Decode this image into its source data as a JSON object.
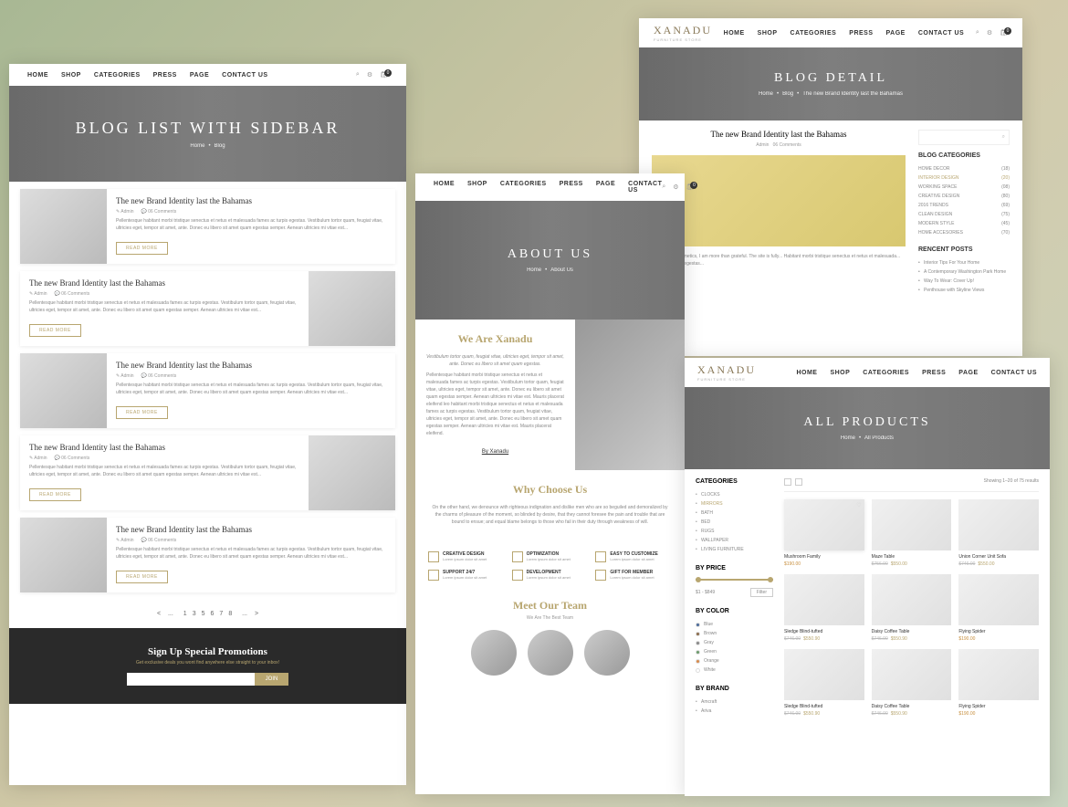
{
  "brand": {
    "name": "XANADU",
    "tagline": "FURNITURE STORE"
  },
  "nav": {
    "home": "HOME",
    "shop": "SHOP",
    "categories": "CATEGORIES",
    "press": "PRESS",
    "page": "PAGE",
    "contact": "CONTACT US"
  },
  "p1": {
    "heroTitle": "BLOG LIST WITH SIDEBAR",
    "breadcrumb": {
      "home": "Home",
      "blog": "Blog"
    },
    "posts": [
      {
        "title": "The new Brand Identity last the Bahamas",
        "author": "Admin",
        "comments": "06 Comments",
        "excerpt": "Pellentesque habitant morbi tristique senectus et netus et malesuada fames ac turpis egestas. Vestibulum tortor quam, feugiat vitae, ultricies eget, tempor sit amet, ante. Donec eu libero sit amet quam egestas semper. Aenean ultricies mi vitae est...",
        "btn": "READ MORE"
      },
      {
        "title": "The new Brand Identity last the Bahamas",
        "author": "Admin",
        "comments": "06 Comments",
        "excerpt": "Pellentesque habitant morbi tristique senectus et netus et malesuada fames ac turpis egestas. Vestibulum tortor quam, feugiat vitae, ultricies eget, tempor sit amet, ante. Donec eu libero sit amet quam egestas semper. Aenean ultricies mi vitae est...",
        "btn": "READ MORE"
      },
      {
        "title": "The new Brand Identity last the Bahamas",
        "author": "Admin",
        "comments": "06 Comments",
        "excerpt": "Pellentesque habitant morbi tristique senectus et netus et malesuada fames ac turpis egestas. Vestibulum tortor quam, feugiat vitae, ultricies eget, tempor sit amet, ante. Donec eu libero sit amet quam egestas semper. Aenean ultricies mi vitae est...",
        "btn": "READ MORE"
      },
      {
        "title": "The new Brand Identity last the Bahamas",
        "author": "Admin",
        "comments": "06 Comments",
        "excerpt": "Pellentesque habitant morbi tristique senectus et netus et malesuada fames ac turpis egestas. Vestibulum tortor quam, feugiat vitae, ultricies eget, tempor sit amet, ante. Donec eu libero sit amet quam egestas semper. Aenean ultricies mi vitae est...",
        "btn": "READ MORE"
      },
      {
        "title": "The new Brand Identity last the Bahamas",
        "author": "Admin",
        "comments": "06 Comments",
        "excerpt": "Pellentesque habitant morbi tristique senectus et netus et malesuada fames ac turpis egestas. Vestibulum tortor quam, feugiat vitae, ultricies eget, tempor sit amet, ante. Donec eu libero sit amet quam egestas semper. Aenean ultricies mi vitae est...",
        "btn": "READ MORE"
      }
    ],
    "pagination": {
      "prev": "<",
      "dots": "...",
      "pages": [
        "1",
        "3",
        "5",
        "6",
        "7",
        "8"
      ],
      "next": ">"
    },
    "signup": {
      "title": "Sign Up Special Promotions",
      "sub": "Get exclusive deals you wont find anywhere else straight to your inbox!",
      "btn": "JOIN"
    }
  },
  "p2": {
    "heroTitle": "ABOUT US",
    "breadcrumb": {
      "home": "Home",
      "about": "About Us"
    },
    "about": {
      "title": "We Are Xanadu",
      "p1": "Vestibulum tortor quam, feugiat vitae, ultricies eget, tempor sit amet, ante. Donec eu libero sit amet quam egestas.",
      "p2": "Pellentesque habitant morbi tristique senectus et netus et malesuada fames ac turpis egestas. Vestibulum tortor quam, feugiat vitae, ultricies eget, tempor sit amet, ante. Donec eu libero sit amet quam egestas semper. Aenean ultricies mi vitae est. Mauris placerat eleifend leo habitant morbi tristique senectus et netus et malesuada fames ac turpis egestas. Vestibulum tortor quam, feugiat vitae, ultricies eget, tempor sit amet, ante. Donec eu libero sit amet quam egestas semper. Aenean ultricies mi vitae est. Mauris placerat eleifend.",
      "link": "By Xanadu"
    },
    "why": {
      "title": "Why Choose Us",
      "sub": "On the other hand, we denounce with righteous indignation and dislike men who are so beguiled and demoralized by the charms of pleasure of the moment, so blinded by desire, that they cannot foresee the pain and trouble that are bound to ensue; and equal blame belongs to those who fail in their duty through weakness of will."
    },
    "features": [
      {
        "title": "CREATIVE DESIGN",
        "desc": "Lorem ipsum dolor sit amet"
      },
      {
        "title": "OPTIMIZATION",
        "desc": "Lorem ipsum dolor sit amet"
      },
      {
        "title": "EASY TO CUSTOMIZE",
        "desc": "Lorem ipsum dolor sit amet"
      },
      {
        "title": "SUPPORT 24/7",
        "desc": "Lorem ipsum dolor sit amet"
      },
      {
        "title": "DEVELOPMENT",
        "desc": "Lorem ipsum dolor sit amet"
      },
      {
        "title": "GIFT FOR MEMBER",
        "desc": "Lorem ipsum dolor sit amet"
      }
    ],
    "team": {
      "title": "Meet Our Team",
      "sub": "We Are The Best Team"
    }
  },
  "p3": {
    "heroTitle": "BLOG DETAIL",
    "breadcrumb": {
      "home": "Home",
      "blog": "Blog",
      "post": "The new Brand Identity last the Bahamas"
    },
    "article": {
      "title": "The new Brand Identity last the Bahamas",
      "author": "Admin",
      "comments": "06 Comments",
      "text": "with the BioCosmetics, I am more than grateful. The site is fully... Habitant morbi tristique senectus et netus et malesuada... fames ac turpis egestas..."
    },
    "sidebarTitle1": "BLOG CATEGORIES",
    "categories": [
      {
        "name": "HOME DECOR",
        "count": "(18)"
      },
      {
        "name": "INTERIOR DESIGN",
        "count": "(20)"
      },
      {
        "name": "WORKING SPACE",
        "count": "(08)"
      },
      {
        "name": "CREATIVE DESIGN",
        "count": "(80)"
      },
      {
        "name": "2016 TRENDS",
        "count": "(69)"
      },
      {
        "name": "CLEAN DESIGN",
        "count": "(75)"
      },
      {
        "name": "MODERN STYLE",
        "count": "(45)"
      },
      {
        "name": "HOME ACCESORIES",
        "count": "(70)"
      }
    ],
    "sidebarTitle2": "RENCENT POSTS",
    "recents": [
      "Interior Tips For Your Home",
      "A Contemporary Washington Park Home",
      "Way To Wear: Cover Up!",
      "Penthouse with Skyline Views"
    ]
  },
  "p4": {
    "heroTitle": "ALL PRODUCTS",
    "breadcrumb": {
      "home": "Home",
      "all": "All Products"
    },
    "catTitle": "CATEGORIES",
    "cats": [
      "CLOCKS",
      "MIRRORS",
      "BATH",
      "BED",
      "RUGS",
      "WALLPAPER",
      "LIVING FURNITURE"
    ],
    "priceTitle": "BY PRICE",
    "priceRange": "$1 - $849",
    "filterBtn": "Filter",
    "colorTitle": "BY COLOR",
    "colors": [
      {
        "name": "Blue",
        "c": "#4a6a9a"
      },
      {
        "name": "Brown",
        "c": "#8a6a4a"
      },
      {
        "name": "Gray",
        "c": "#888"
      },
      {
        "name": "Green",
        "c": "#6a9a6a"
      },
      {
        "name": "Orange",
        "c": "#d88a4a"
      },
      {
        "name": "White",
        "c": "#fff"
      }
    ],
    "brandTitle": "BY BRAND",
    "brands": [
      "Amcraft",
      "Ariva"
    ],
    "resultsText": "Showing 1–20 of 75 results",
    "products": [
      {
        "name": "Mushroom Family",
        "old": "",
        "new": "$190.00",
        "sale": true
      },
      {
        "name": "Maze Table",
        "old": "$756.00",
        "new": "$550.00"
      },
      {
        "name": "Union Corner Unit Sofa",
        "old": "$746.00",
        "new": "$550.00"
      },
      {
        "name": "Sledge Blind-tufted",
        "old": "$746.00",
        "new": "$550.90"
      },
      {
        "name": "Daisy Coffee Table",
        "old": "$746.00",
        "new": "$550.90"
      },
      {
        "name": "Flying Spider",
        "old": "",
        "new": "$190.00",
        "sale": true
      },
      {
        "name": "Sledge Blind-tufted",
        "old": "$746.00",
        "new": "$550.90"
      },
      {
        "name": "Daisy Coffee Table",
        "old": "$746.00",
        "new": "$550.90"
      },
      {
        "name": "Flying Spider",
        "old": "",
        "new": "$190.00",
        "sale": true
      }
    ]
  }
}
